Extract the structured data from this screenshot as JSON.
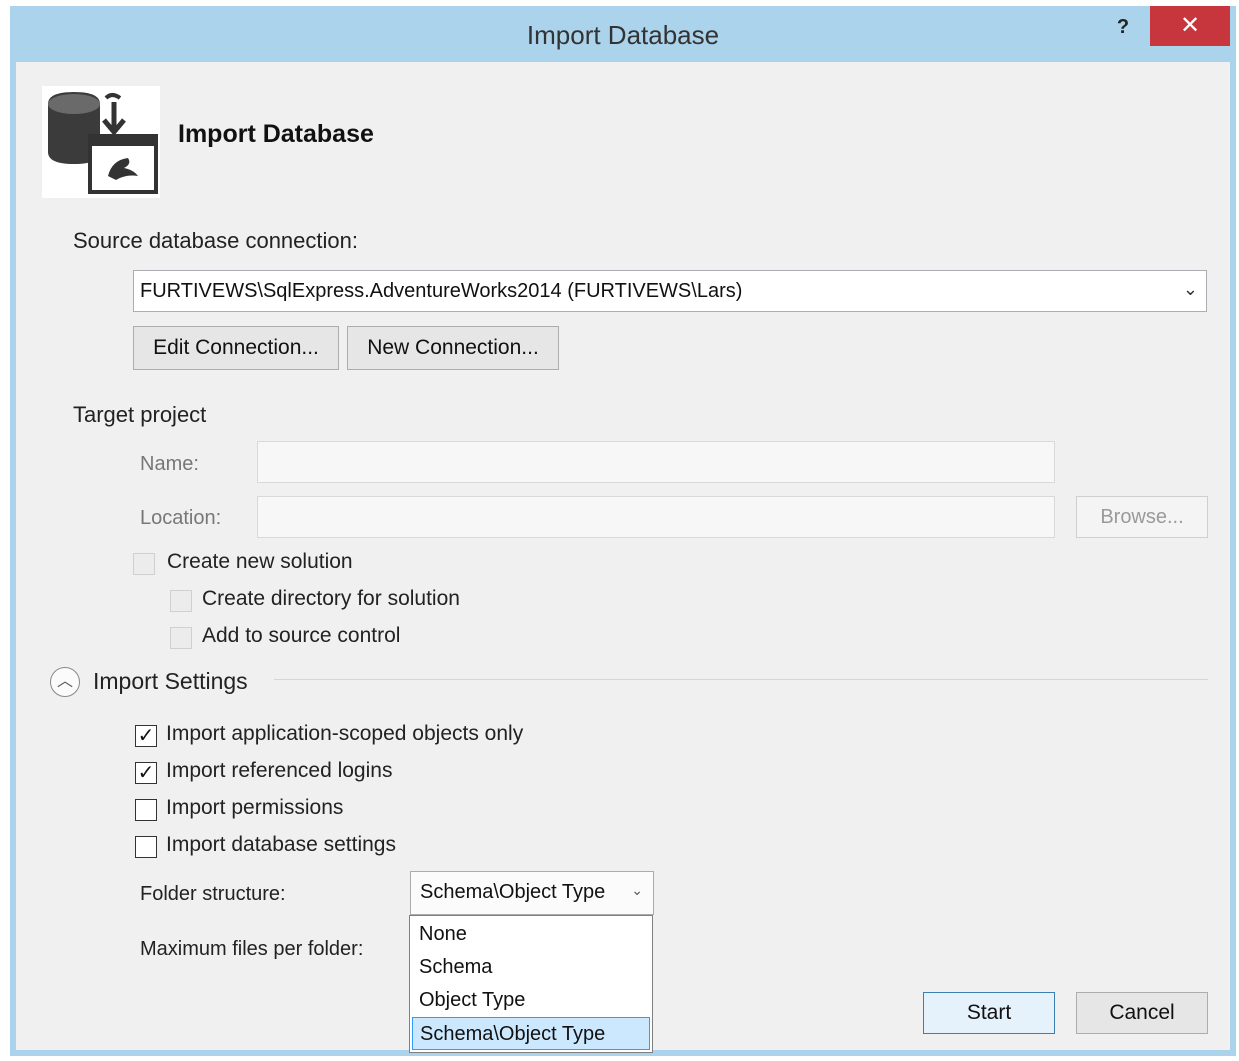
{
  "window": {
    "title": "Import Database",
    "help_label": "?",
    "close_label": "✕"
  },
  "header": {
    "title": "Import Database"
  },
  "source": {
    "label": "Source database connection:",
    "connection_value": "FURTIVEWS\\SqlExpress.AdventureWorks2014 (FURTIVEWS\\Lars)",
    "edit_button": "Edit Connection...",
    "new_button": "New Connection..."
  },
  "target": {
    "label": "Target project",
    "name_label": "Name:",
    "name_value": "",
    "location_label": "Location:",
    "location_value": "",
    "browse_button": "Browse...",
    "create_solution": "Create new solution",
    "create_directory": "Create directory for solution",
    "add_source_control": "Add to source control"
  },
  "settings": {
    "label": "Import Settings",
    "options": [
      {
        "label": "Import application-scoped objects only",
        "checked": true
      },
      {
        "label": "Import referenced logins",
        "checked": true
      },
      {
        "label": "Import permissions",
        "checked": false
      },
      {
        "label": "Import database settings",
        "checked": false
      }
    ],
    "folder_label": "Folder structure:",
    "folder_value": "Schema\\Object Type",
    "folder_options": [
      "None",
      "Schema",
      "Object Type",
      "Schema\\Object Type"
    ],
    "max_files_label": "Maximum files per folder:"
  },
  "footer": {
    "start_button": "Start",
    "cancel_button": "Cancel"
  }
}
